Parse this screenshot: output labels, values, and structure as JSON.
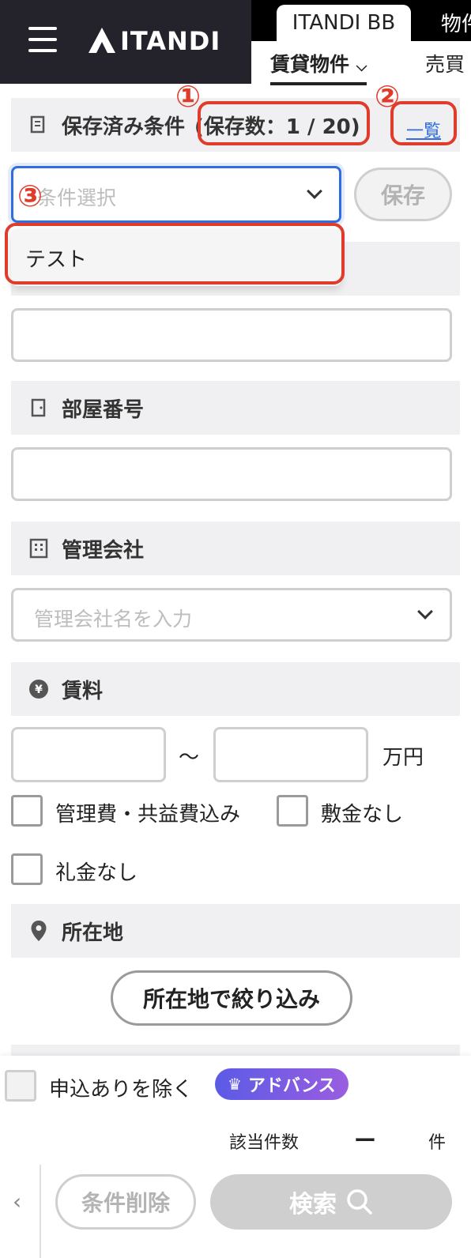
{
  "header": {
    "logo_text": "ITANDI",
    "tab_bb": "ITANDI BB",
    "tab_next": "物件",
    "nav_rent": "賃貸物件",
    "nav_sale": "売買"
  },
  "saved": {
    "title": "保存済み条件",
    "count": "(保存数：1 / 20)",
    "list_link": "一覧",
    "select_placeholder": "条件選択",
    "save_button": "保存",
    "option": "テスト"
  },
  "annotations": {
    "n1": "①",
    "n2": "②",
    "n3": "③"
  },
  "room": {
    "title": "部屋番号"
  },
  "company": {
    "title": "管理会社",
    "placeholder": "管理会社名を入力"
  },
  "rent": {
    "title": "賃料",
    "tilde": "〜",
    "unit": "万円",
    "opt1": "管理費・共益費込み",
    "opt2": "敷金なし",
    "opt3": "礼金なし"
  },
  "location": {
    "title": "所在地",
    "button": "所在地で絞り込み"
  },
  "footer": {
    "exclude": "申込ありを除く",
    "advance": "アドバンス",
    "count_label": "該当件数",
    "count_value": "ー",
    "count_unit": "件",
    "back": "‹",
    "clear": "条件削除",
    "search": "検索"
  },
  "colors": {
    "accent": "#e03c2c",
    "focus": "#2f6de1",
    "advance_from": "#5b5be6",
    "advance_to": "#9a5de0"
  }
}
